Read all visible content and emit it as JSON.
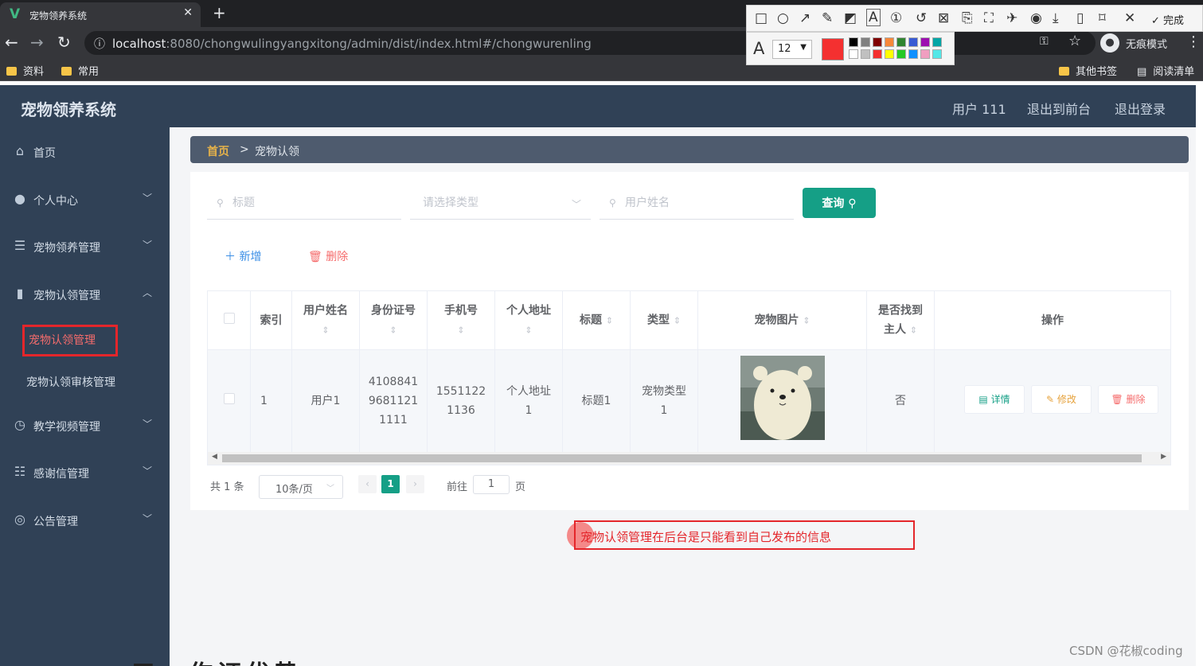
{
  "browser": {
    "tab_title": "宠物领养系统",
    "url_host": "localhost",
    "url_rest": ":8080/chongwulingyangxitong/admin/dist/index.html#/chongwurenling",
    "incognito_label": "无痕模式",
    "bookmarks": [
      "资料",
      "常用"
    ],
    "bookmarks_right": [
      "其他书签",
      "阅读清单"
    ]
  },
  "annotation_tool": {
    "done_label": "完成",
    "font_size": "12",
    "current_color": "#f43030",
    "palette": [
      "#000000",
      "#808080",
      "#800000",
      "#f7883a",
      "#308430",
      "#385ad3",
      "#9c0eb0",
      "#04a6a6",
      "#ffffff",
      "#c0c0c0",
      "#f43030",
      "#ffff00",
      "#24c924",
      "#1090ff",
      "#f09ec0",
      "#54e7e7"
    ]
  },
  "header": {
    "title": "宠物领养系统",
    "user": "用户 111",
    "back_front": "退出到前台",
    "logout": "退出登录"
  },
  "sidebar": {
    "items": [
      {
        "label": "首页",
        "icon": "home-icon"
      },
      {
        "label": "个人中心",
        "icon": "user-icon"
      },
      {
        "label": "宠物领养管理",
        "icon": "list-icon"
      },
      {
        "label": "宠物认领管理",
        "icon": "chart-icon"
      },
      {
        "label": "教学视频管理",
        "icon": "video-icon"
      },
      {
        "label": "感谢信管理",
        "icon": "sliders-icon"
      },
      {
        "label": "公告管理",
        "icon": "compass-icon"
      }
    ],
    "sub_items": [
      "宠物认领管理",
      "宠物认领审核管理"
    ]
  },
  "breadcrumb": {
    "home": "首页",
    "sep": ">",
    "current": "宠物认领"
  },
  "search": {
    "title_placeholder": "标题",
    "type_placeholder": "请选择类型",
    "username_placeholder": "用户姓名",
    "query_label": "查询"
  },
  "actions": {
    "add": "新增",
    "delete": "删除"
  },
  "table": {
    "headers": {
      "index": "索引",
      "username": "用户姓名",
      "idcard": "身份证号",
      "phone": "手机号",
      "address": "个人地址",
      "title": "标题",
      "type": "类型",
      "image": "宠物图片",
      "found1": "是否找到",
      "found2": "主人",
      "op": "操作"
    },
    "row": {
      "index": "1",
      "username": "用户1",
      "idcard": [
        "4108841",
        "9681121",
        "1111"
      ],
      "phone": [
        "1551122",
        "1136"
      ],
      "address": [
        "个人地址",
        "1"
      ],
      "title": "标题1",
      "type": [
        "宠物类型",
        "1"
      ],
      "found": "否",
      "btn_detail": "详情",
      "btn_edit": "修改",
      "btn_delete": "删除"
    }
  },
  "pagination": {
    "total": "共 1 条",
    "page_size": "10条/页",
    "current": "1",
    "goto": "前往",
    "goto_value": "1",
    "page_unit": "页"
  },
  "note": "宠物认领管理在后台是只能看到自己发布的信息",
  "watermark": "CSDN @花椒coding",
  "cutoff_text": "五、作证优势"
}
